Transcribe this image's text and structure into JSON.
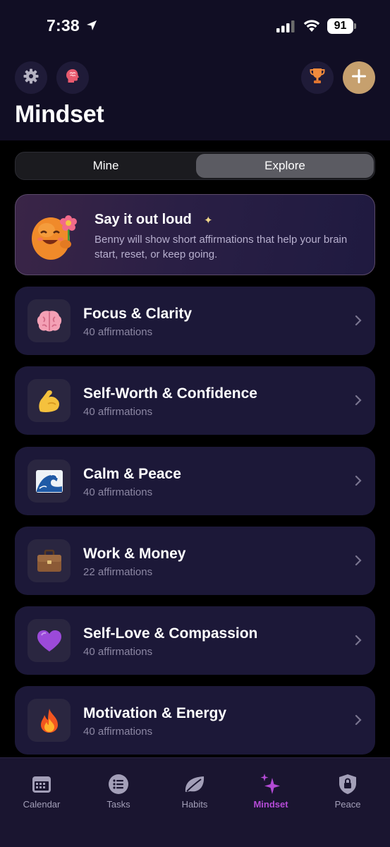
{
  "status_bar": {
    "time": "7:38",
    "battery": "91"
  },
  "header": {
    "title": "Mindset",
    "icons": [
      "gear-icon",
      "brain-icon",
      "trophy-icon",
      "plus-icon"
    ]
  },
  "segment": {
    "options": [
      "Mine",
      "Explore"
    ],
    "selected": "Explore"
  },
  "promo": {
    "title": "Say it out loud",
    "text": "Benny will show short affirmations that help your brain start, reset, or keep going."
  },
  "categories": [
    {
      "emoji": "🧠",
      "title": "Focus & Clarity",
      "count": "40 affirmations"
    },
    {
      "emoji": "💪",
      "title": "Self-Worth & Confidence",
      "count": "40 affirmations"
    },
    {
      "emoji": "🌊",
      "title": "Calm & Peace",
      "count": "40 affirmations"
    },
    {
      "emoji": "💼",
      "title": "Work & Money",
      "count": "22 affirmations"
    },
    {
      "emoji": "💜",
      "title": "Self-Love & Compassion",
      "count": "40 affirmations"
    },
    {
      "emoji": "🔥",
      "title": "Motivation & Energy",
      "count": "40 affirmations"
    }
  ],
  "tabbar": {
    "tabs": [
      {
        "label": "Calendar",
        "icon": "calendar-icon"
      },
      {
        "label": "Tasks",
        "icon": "list-icon"
      },
      {
        "label": "Habits",
        "icon": "leaf-icon"
      },
      {
        "label": "Mindset",
        "icon": "sparkles-icon"
      },
      {
        "label": "Peace",
        "icon": "shield-lock-icon"
      }
    ],
    "active": "Mindset"
  },
  "colors": {
    "header_bg": "#110e24",
    "card_bg": "#1c1838",
    "accent_active": "#b44bd6",
    "add_button": "#c6a06e"
  }
}
